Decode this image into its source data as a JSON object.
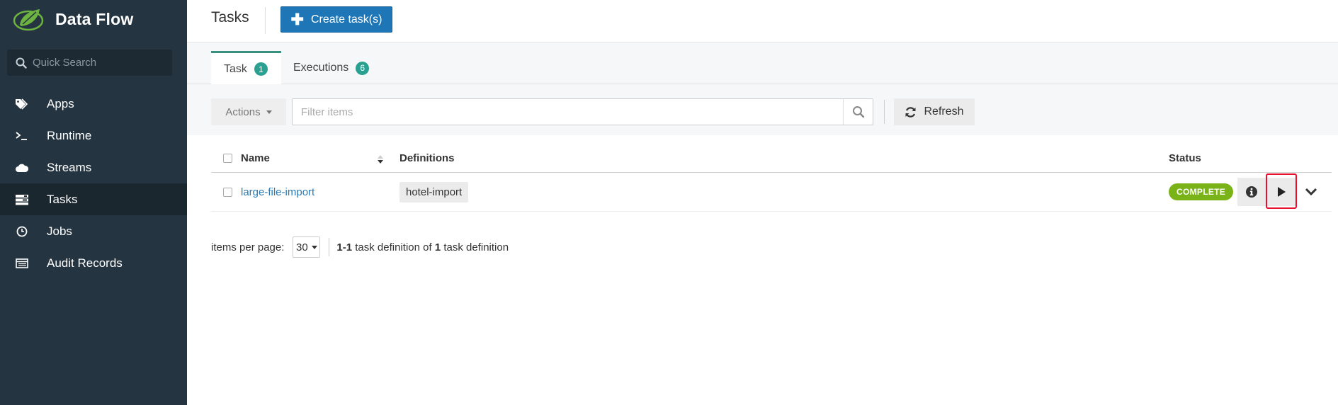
{
  "app": {
    "name": "Data Flow"
  },
  "sidebar": {
    "search_placeholder": "Quick Search",
    "items": [
      {
        "label": "Apps",
        "icon": "tags-icon"
      },
      {
        "label": "Runtime",
        "icon": "terminal-icon"
      },
      {
        "label": "Streams",
        "icon": "cloud-icon"
      },
      {
        "label": "Tasks",
        "icon": "tasks-icon",
        "active": true
      },
      {
        "label": "Jobs",
        "icon": "clock-icon"
      },
      {
        "label": "Audit Records",
        "icon": "list-icon"
      }
    ]
  },
  "header": {
    "title": "Tasks",
    "create_button": "Create task(s)"
  },
  "tabs": [
    {
      "label": "Task",
      "count": "1",
      "active": true
    },
    {
      "label": "Executions",
      "count": "6"
    }
  ],
  "toolbar": {
    "actions_label": "Actions",
    "filter_placeholder": "Filter items",
    "refresh_label": "Refresh"
  },
  "table": {
    "columns": {
      "name": "Name",
      "definitions": "Definitions",
      "status": "Status"
    },
    "rows": [
      {
        "name": "large-file-import",
        "definition": "hotel-import",
        "status": "COMPLETE"
      }
    ]
  },
  "pager": {
    "items_per_page_label": "items per page:",
    "per_page_value": "30",
    "range": "1-1",
    "text_mid": "task definition of",
    "total": "1",
    "text_end": "task definition"
  },
  "colors": {
    "sidebar_bg": "#243440",
    "primary": "#1e76b6",
    "badge": "#2aa190",
    "status_complete": "#7ab317",
    "highlight": "#e8112d"
  }
}
